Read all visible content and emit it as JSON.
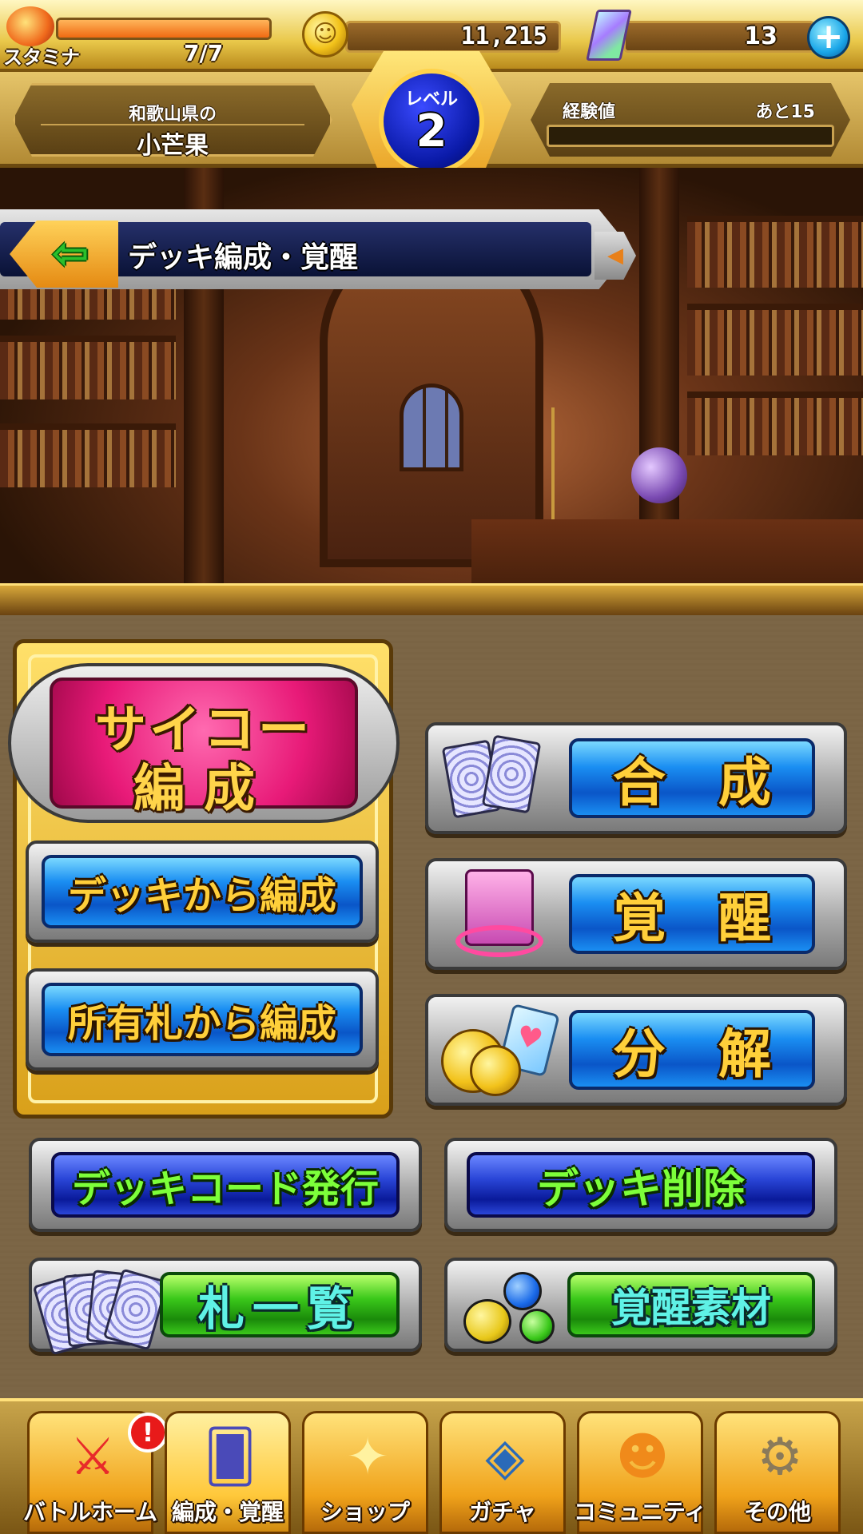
{
  "status": {
    "stamina_label": "スタミナ",
    "stamina_value": "7/7",
    "stamina_fraction": 1.0,
    "coins": "11,215",
    "gems": "13",
    "coin_symbol": "☺",
    "plus_symbol": "+"
  },
  "player": {
    "prefecture": "和歌山県の",
    "name": "小芒果",
    "level_label": "レベル",
    "level": "2",
    "exp_label": "経験値",
    "exp_remaining": "あと15",
    "exp_fraction": 0.0
  },
  "screen": {
    "back_icon": "⇦",
    "title": "デッキ編成・覚醒",
    "collapse_icon": "◀"
  },
  "menu": {
    "psycho_line1": "サイコー",
    "psycho_line2": "編成",
    "from_deck": "デッキから編成",
    "from_owned": "所有札から編成",
    "fusion": "合　成",
    "awaken": "覚　醒",
    "dismantle": "分　解",
    "issue_code": "デッキコード発行",
    "delete_deck": "デッキ削除",
    "card_list": "札一覧",
    "awaken_materials": "覚醒素材"
  },
  "nav": {
    "alert": "!",
    "items": [
      {
        "label": "バトルホーム",
        "icon": "battle-home-icon",
        "glyph": "⚔"
      },
      {
        "label": "編成・覚醒",
        "icon": "deck-edit-icon",
        "glyph": "🂠"
      },
      {
        "label": "ショップ",
        "icon": "shop-icon",
        "glyph": "✦"
      },
      {
        "label": "ガチャ",
        "icon": "gacha-icon",
        "glyph": "◈"
      },
      {
        "label": "コミュニティ",
        "icon": "community-icon",
        "glyph": "☻"
      },
      {
        "label": "その他",
        "icon": "settings-gears-icon",
        "glyph": "⚙"
      }
    ]
  },
  "colors": {
    "gold": "#ffcf3a",
    "blue_button": "#1a8ef2",
    "navy_button": "#2a46d8",
    "green_button": "#3ac81a",
    "psycho_pink": "#e81a78"
  }
}
